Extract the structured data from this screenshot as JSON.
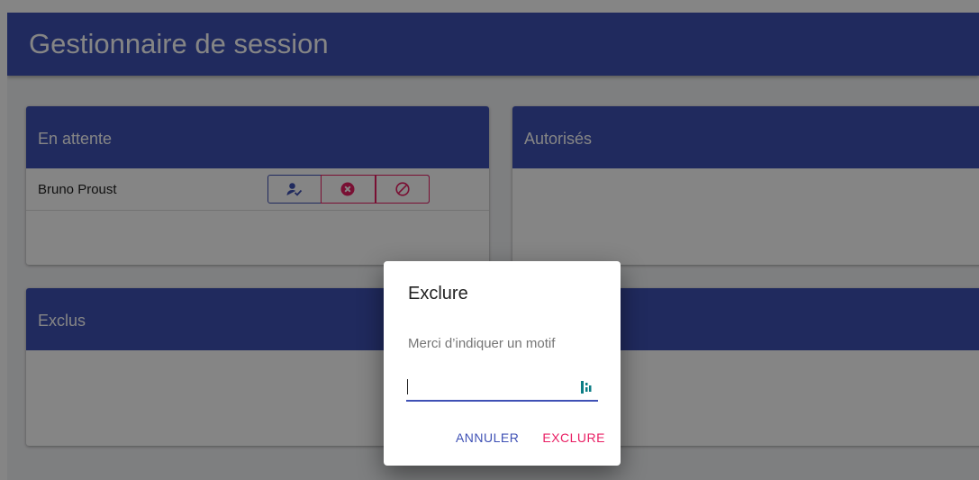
{
  "app": {
    "title": "Gestionnaire de session"
  },
  "panels": {
    "pending": {
      "title": "En attente",
      "rows": [
        {
          "name": "Bruno Proust"
        }
      ],
      "actions": [
        {
          "icon": "approve-user-icon",
          "color": "#3f51b5"
        },
        {
          "icon": "reject-circle-x-icon",
          "color": "#e91e63"
        },
        {
          "icon": "ban-icon",
          "color": "#e91e63"
        }
      ]
    },
    "authorized": {
      "title": "Autorisés"
    },
    "excluded": {
      "title": "Exclus"
    }
  },
  "dialog": {
    "title": "Exclure",
    "message": "Merci d’indiquer un motif",
    "input_value": "",
    "input_icon": "keyboard-extension-icon",
    "cancel_label": "ANNULER",
    "confirm_label": "EXCLURE"
  },
  "colors": {
    "primary": "#3f51b5",
    "accent": "#e91e63",
    "background": "#f2f3f5",
    "overlay": "rgba(0,0,0,0.48)"
  }
}
